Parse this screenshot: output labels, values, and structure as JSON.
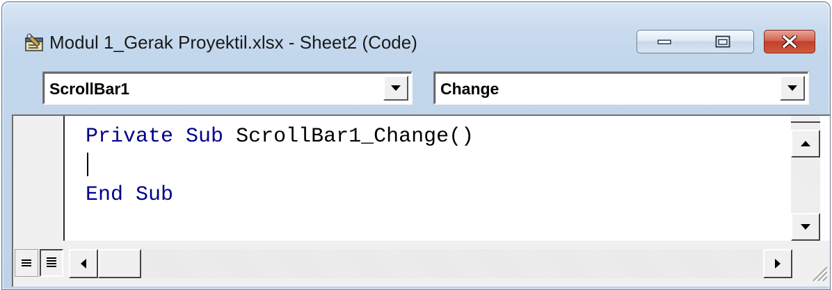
{
  "window": {
    "title": "Modul 1_Gerak Proyektil.xlsx - Sheet2 (Code)"
  },
  "toolbar": {
    "object_combo": "ScrollBar1",
    "procedure_combo": "Change"
  },
  "code": {
    "line1_keyword1": "Private",
    "line1_keyword2": "Sub",
    "line1_name": "ScrollBar1_Change()",
    "line3_keyword1": "End",
    "line3_keyword2": "Sub"
  },
  "colors": {
    "keyword": "#00008b",
    "close_button": "#c2402a"
  },
  "icons": {
    "app": "vba-code-window-icon",
    "minimize": "minimize-icon",
    "maximize": "maximize-icon",
    "close": "close-icon",
    "procedure_view": "procedure-view-icon",
    "full_module_view": "full-module-view-icon"
  }
}
